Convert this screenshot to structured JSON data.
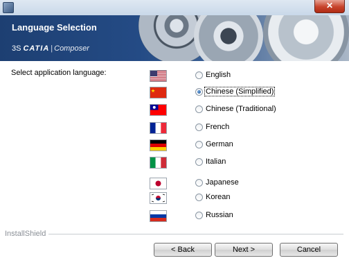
{
  "window": {
    "close_label": "✕"
  },
  "banner": {
    "title": "Language Selection",
    "logo_mark": "3S",
    "logo_brand": "CATIA",
    "logo_sep": "|",
    "logo_product": "Composer"
  },
  "main": {
    "prompt": "Select application language:",
    "languages": [
      {
        "label": "English",
        "flag": "us-flag-icon",
        "selected": false
      },
      {
        "label": "Chinese (Simplified)",
        "flag": "china-flag-icon",
        "selected": true
      },
      {
        "label": "Chinese (Traditional)",
        "flag": "taiwan-flag-icon",
        "selected": false
      },
      {
        "label": "French",
        "flag": "france-flag-icon",
        "selected": false
      },
      {
        "label": "German",
        "flag": "germany-flag-icon",
        "selected": false
      },
      {
        "label": "Italian",
        "flag": "italy-flag-icon",
        "selected": false
      },
      {
        "label": "Japanese",
        "flag": "japan-flag-icon",
        "selected": false
      },
      {
        "label": "Korean",
        "flag": "korea-flag-icon",
        "selected": false
      },
      {
        "label": "Russian",
        "flag": "russia-flag-icon",
        "selected": false
      }
    ]
  },
  "footer": {
    "brand": "InstallShield",
    "back_label": "< Back",
    "next_label": "Next >",
    "cancel_label": "Cancel"
  }
}
